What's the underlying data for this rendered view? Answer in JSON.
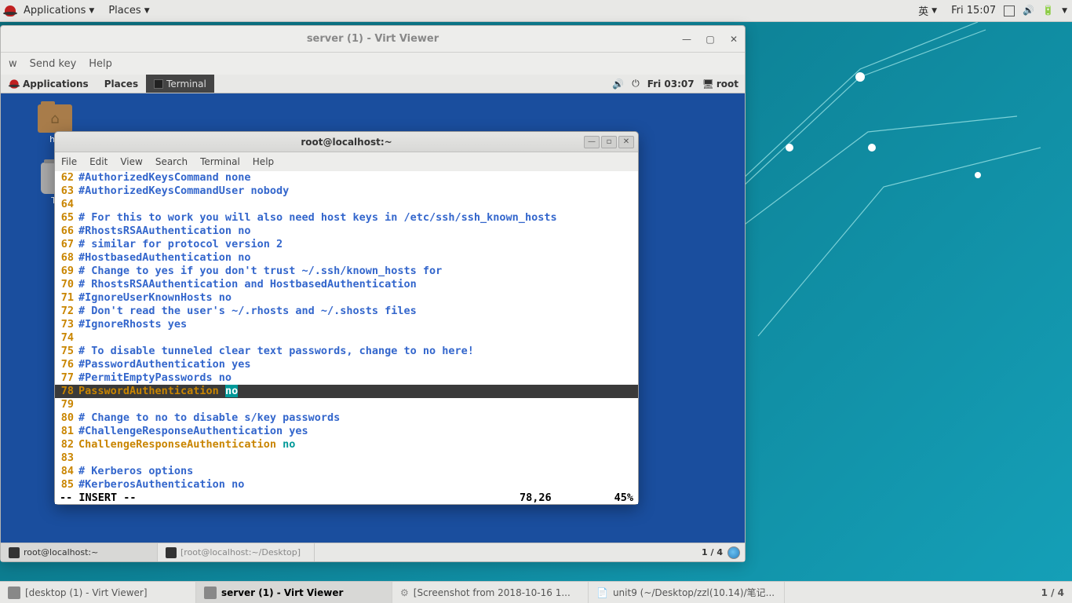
{
  "host_topbar": {
    "applications": "Applications",
    "places": "Places",
    "ime": "英",
    "clock": "Fri 15:07"
  },
  "virt": {
    "title": "server (1) - Virt Viewer",
    "menu": {
      "w": "w",
      "sendkey": "Send key",
      "help": "Help"
    }
  },
  "guest_topbar": {
    "applications": "Applications",
    "places": "Places",
    "terminal": "Terminal",
    "clock": "Fri 03:07",
    "user": "root"
  },
  "guest_icons": {
    "home": "ho",
    "trash": "Tr"
  },
  "term": {
    "title": "root@localhost:~",
    "menu": {
      "file": "File",
      "edit": "Edit",
      "view": "View",
      "search": "Search",
      "terminal": "Terminal",
      "help": "Help"
    },
    "status": {
      "mode": "-- INSERT --",
      "pos": "78,26",
      "pct": "45%"
    },
    "lines": [
      {
        "n": "62",
        "t": "#AuthorizedKeysCommand none",
        "c": "b"
      },
      {
        "n": "63",
        "t": "#AuthorizedKeysCommandUser nobody",
        "c": "b"
      },
      {
        "n": "64",
        "t": "",
        "c": "b"
      },
      {
        "n": "65",
        "t": "# For this to work you will also need host keys in /etc/ssh/ssh_known_hosts",
        "c": "b"
      },
      {
        "n": "66",
        "t": "#RhostsRSAAuthentication no",
        "c": "b"
      },
      {
        "n": "67",
        "t": "# similar for protocol version 2",
        "c": "b"
      },
      {
        "n": "68",
        "t": "#HostbasedAuthentication no",
        "c": "b"
      },
      {
        "n": "69",
        "t": "# Change to yes if you don't trust ~/.ssh/known_hosts for",
        "c": "b"
      },
      {
        "n": "70",
        "t": "# RhostsRSAAuthentication and HostbasedAuthentication",
        "c": "b"
      },
      {
        "n": "71",
        "t": "#IgnoreUserKnownHosts no",
        "c": "b"
      },
      {
        "n": "72",
        "t": "# Don't read the user's ~/.rhosts and ~/.shosts files",
        "c": "b"
      },
      {
        "n": "73",
        "t": "#IgnoreRhosts yes",
        "c": "b"
      },
      {
        "n": "74",
        "t": "",
        "c": "b"
      },
      {
        "n": "75",
        "t": "# To disable tunneled clear text passwords, change to no here!",
        "c": "b"
      },
      {
        "n": "76",
        "t": "#PasswordAuthentication yes",
        "c": "b"
      },
      {
        "n": "77",
        "t": "#PermitEmptyPasswords no",
        "c": "b"
      },
      {
        "n": "78",
        "key": "PasswordAuthentication ",
        "val": "no",
        "c": "hl"
      },
      {
        "n": "79",
        "t": "",
        "c": "b"
      },
      {
        "n": "80",
        "t": "# Change to no to disable s/key passwords",
        "c": "b"
      },
      {
        "n": "81",
        "t": "#ChallengeResponseAuthentication yes",
        "c": "b"
      },
      {
        "n": "82",
        "key": "ChallengeResponseAuthentication ",
        "val": "no",
        "c": "kv"
      },
      {
        "n": "83",
        "t": "",
        "c": "b"
      },
      {
        "n": "84",
        "t": "# Kerberos options",
        "c": "b"
      },
      {
        "n": "85",
        "t": "#KerberosAuthentication no",
        "c": "b"
      }
    ]
  },
  "guest_taskbar": {
    "task1": "root@localhost:~",
    "task2": "[root@localhost:~/Desktop]",
    "ws": "1 / 4"
  },
  "host_taskbar": {
    "task1": "[desktop (1) - Virt Viewer]",
    "task2": "server (1) - Virt Viewer",
    "task3": "[Screenshot from 2018-10-16 1...",
    "task4": "unit9 (~/Desktop/zzl(10.14)/笔记...",
    "ws": "1 / 4"
  }
}
